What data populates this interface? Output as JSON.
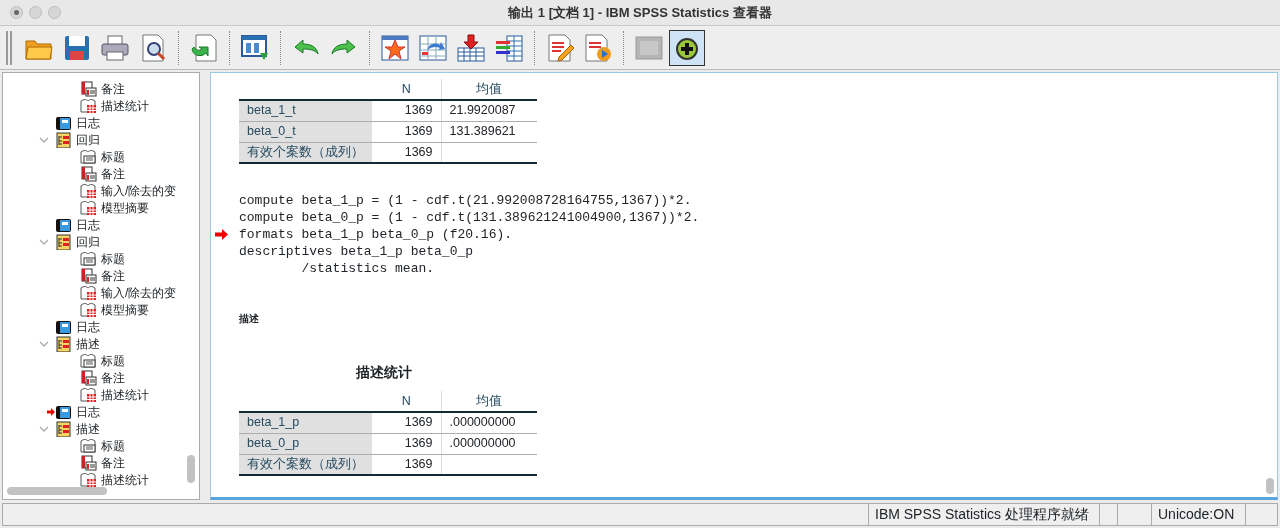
{
  "window": {
    "title": "输出 1 [文档 1] - IBM SPSS Statistics 查看器"
  },
  "toolbar": {
    "buttons": [
      {
        "disabled": false,
        "pressed": false
      },
      {
        "disabled": false,
        "pressed": false
      },
      {
        "disabled": false,
        "pressed": false
      },
      {
        "disabled": false,
        "pressed": false
      },
      {
        "disabled": false,
        "pressed": false
      },
      {
        "disabled": false,
        "pressed": false
      },
      {
        "disabled": false,
        "pressed": false
      },
      {
        "disabled": false,
        "pressed": false
      },
      {
        "disabled": false,
        "pressed": false
      },
      {
        "disabled": false,
        "pressed": false
      },
      {
        "disabled": false,
        "pressed": false
      },
      {
        "disabled": false,
        "pressed": false
      },
      {
        "disabled": false,
        "pressed": false
      },
      {
        "disabled": false,
        "pressed": false
      },
      {
        "disabled": true,
        "pressed": false
      },
      {
        "disabled": false,
        "pressed": true
      }
    ]
  },
  "outline": {
    "orphan_items": [
      {
        "kind": "note",
        "label": "备注"
      },
      {
        "kind": "table",
        "label": "描述统计"
      }
    ],
    "items": [
      {
        "kind": "log",
        "label": "日志",
        "current": false
      },
      {
        "kind": "section",
        "label": "回归",
        "expanded": true,
        "children": [
          {
            "kind": "title",
            "label": "标题"
          },
          {
            "kind": "note",
            "label": "备注"
          },
          {
            "kind": "table",
            "label": "输入/除去的变"
          },
          {
            "kind": "table",
            "label": "模型摘要"
          }
        ]
      },
      {
        "kind": "log",
        "label": "日志",
        "current": false
      },
      {
        "kind": "section",
        "label": "回归",
        "expanded": true,
        "children": [
          {
            "kind": "title",
            "label": "标题"
          },
          {
            "kind": "note",
            "label": "备注"
          },
          {
            "kind": "table",
            "label": "输入/除去的变"
          },
          {
            "kind": "table",
            "label": "模型摘要"
          }
        ]
      },
      {
        "kind": "log",
        "label": "日志",
        "current": false
      },
      {
        "kind": "section",
        "label": "描述",
        "expanded": true,
        "children": [
          {
            "kind": "title",
            "label": "标题"
          },
          {
            "kind": "note",
            "label": "备注"
          },
          {
            "kind": "table",
            "label": "描述统计"
          }
        ]
      },
      {
        "kind": "log",
        "label": "日志",
        "current": true
      },
      {
        "kind": "section",
        "label": "描述",
        "expanded": true,
        "children": [
          {
            "kind": "title",
            "label": "标题"
          },
          {
            "kind": "note",
            "label": "备注"
          },
          {
            "kind": "table",
            "label": "描述统计"
          }
        ]
      }
    ]
  },
  "output": [
    {
      "kind": "table",
      "columns": [
        "N",
        "均值"
      ],
      "rows": [
        {
          "label": "beta_1_t",
          "cells": [
            "1369",
            "21.9920087"
          ]
        },
        {
          "label": "beta_0_t",
          "cells": [
            "1369",
            "131.389621"
          ]
        },
        {
          "label": "有效个案数（成列）",
          "cells": [
            "1369",
            ""
          ]
        }
      ]
    },
    {
      "kind": "log",
      "lines": [
        {
          "text": "compute beta_1_p = (1 - cdf.t(21.992008728164755,1367))*2.",
          "current": false
        },
        {
          "text": "compute beta_0_p = (1 - cdf.t(131.389621241004900,1367))*2.",
          "current": false
        },
        {
          "text": "formats beta_1_p beta_0_p (f20.16).",
          "current": true
        },
        {
          "text": "descriptives beta_1_p beta_0_p",
          "current": false
        },
        {
          "text": "        /statistics mean.",
          "current": false
        }
      ]
    },
    {
      "kind": "heading",
      "text": "描述"
    },
    {
      "kind": "table",
      "title": "描述统计",
      "columns": [
        "N",
        "均值"
      ],
      "rows": [
        {
          "label": "beta_1_p",
          "cells": [
            "1369",
            ".000000000"
          ]
        },
        {
          "label": "beta_0_p",
          "cells": [
            "1369",
            ".000000000"
          ]
        },
        {
          "label": "有效个案数（成列）",
          "cells": [
            "1369",
            ""
          ]
        }
      ]
    }
  ],
  "status_bar": {
    "message": "IBM SPSS Statistics 处理程序就绪",
    "encoding": "Unicode:ON"
  }
}
